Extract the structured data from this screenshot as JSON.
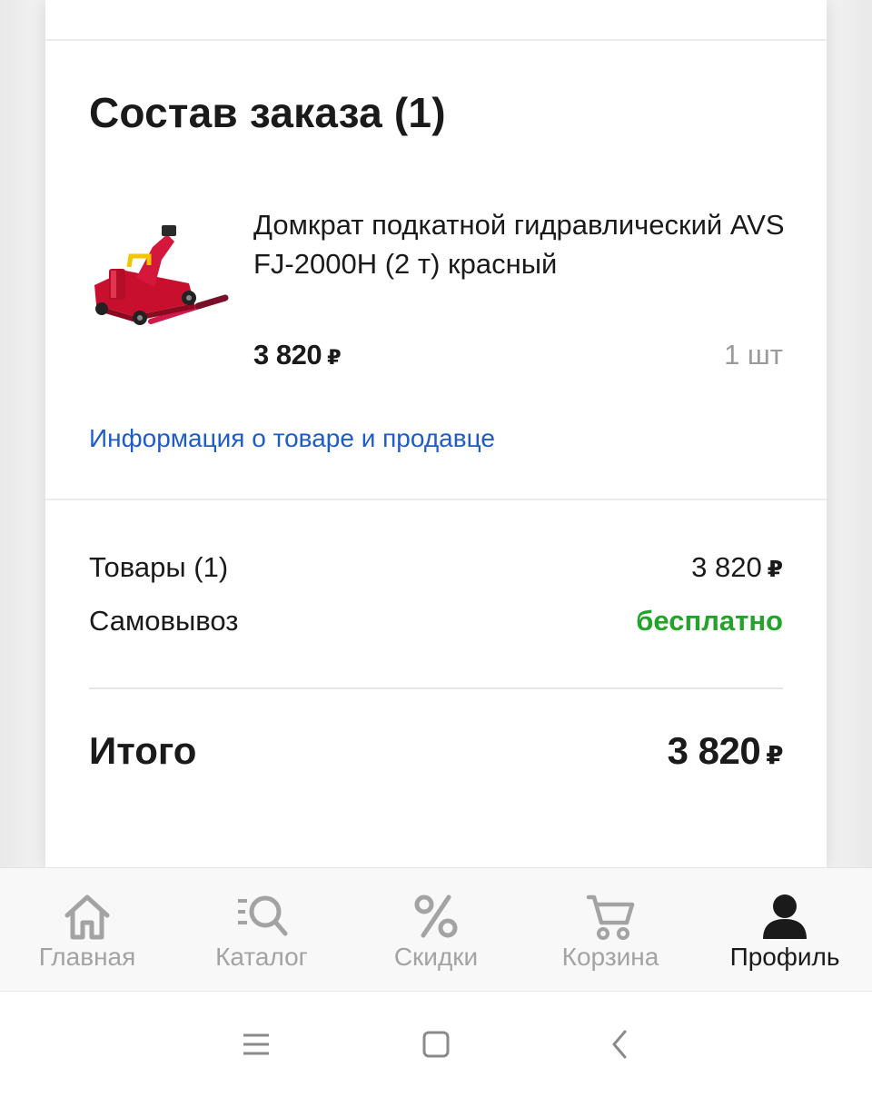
{
  "order": {
    "title": "Состав заказа (1)",
    "product": {
      "image_icon": "car-jack-image",
      "name": "Домкрат подкатной гидравлический AVS FJ-2000H (2 т) красный",
      "price": "3 820",
      "currency": "₽",
      "quantity": "1 шт"
    },
    "info_link": "Информация о товаре и продавце"
  },
  "summary": {
    "goods_label": "Товары (1)",
    "goods_value": "3 820",
    "pickup_label": "Самовывоз",
    "pickup_value": "бесплатно",
    "total_label": "Итого",
    "total_value": "3 820",
    "currency": "₽"
  },
  "tabbar": {
    "items": [
      {
        "label": "Главная",
        "icon": "home-icon",
        "active": false
      },
      {
        "label": "Каталог",
        "icon": "catalog-search-icon",
        "active": false
      },
      {
        "label": "Скидки",
        "icon": "percent-icon",
        "active": false
      },
      {
        "label": "Корзина",
        "icon": "cart-icon",
        "active": false
      },
      {
        "label": "Профиль",
        "icon": "profile-icon",
        "active": true
      }
    ]
  },
  "system_nav": {
    "buttons": [
      "menu-icon",
      "home-square-icon",
      "back-icon"
    ]
  },
  "colors": {
    "link": "#1e5dc8",
    "free": "#24a32b",
    "tab_inactive": "#a3a3a3",
    "tab_active": "#1a1a1a"
  }
}
